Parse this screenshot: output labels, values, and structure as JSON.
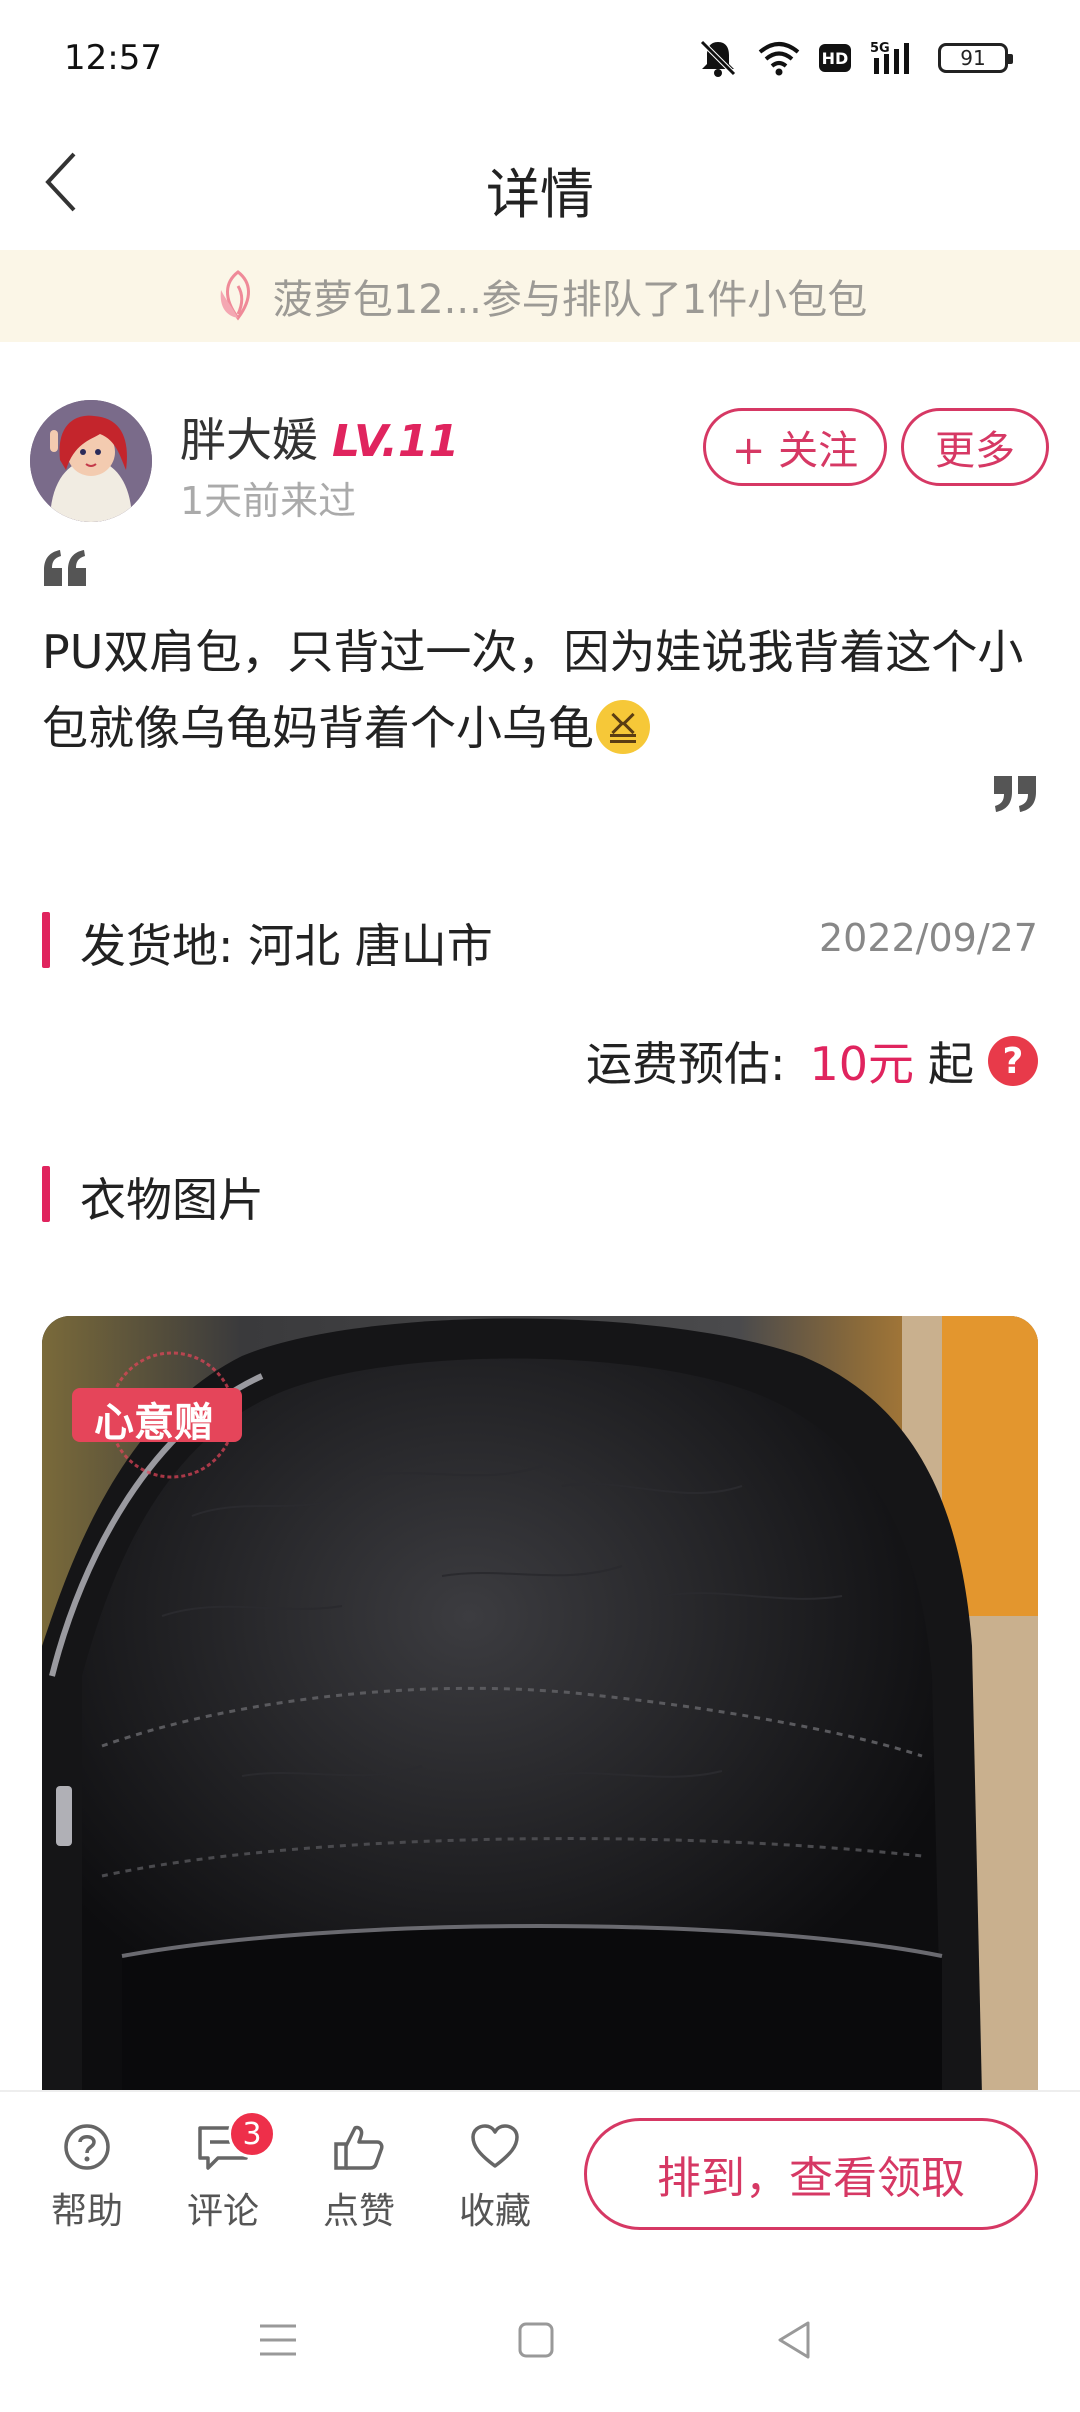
{
  "status_bar": {
    "time": "12:57",
    "battery": "91",
    "network": "5G",
    "hd": "HD"
  },
  "header": {
    "title": "详情"
  },
  "notice": {
    "text": "菠萝包12...参与排队了1件小包包"
  },
  "user": {
    "name": "胖大媛",
    "level": "LV.11",
    "last_seen": "1天前来过",
    "follow_label": "+ 关注",
    "more_label": "更多"
  },
  "post": {
    "description": "PU双肩包，只背过一次，因为娃说我背着这个小包就像乌龟妈背着个小乌龟"
  },
  "location": {
    "label": "发货地: 河北 唐山市",
    "date": "2022/09/27"
  },
  "shipping": {
    "label": "运费预估:",
    "price": "10元",
    "suffix": "起",
    "help_symbol": "?"
  },
  "photos": {
    "section_title": "衣物图片",
    "stamp_text": "心意赠"
  },
  "bottom_bar": {
    "help_label": "帮助",
    "comment_label": "评论",
    "comment_count": "3",
    "like_label": "点赞",
    "favorite_label": "收藏",
    "claim_label": "排到，查看领取"
  },
  "colors": {
    "accent": "#e0245e",
    "banner_bg": "#fbf6e7"
  },
  "icons": [
    "back-icon",
    "flower-icon",
    "quote-open-icon",
    "quote-close-icon",
    "help-icon",
    "comment-icon",
    "like-icon",
    "favorite-icon",
    "menu-icon",
    "home-icon",
    "back-nav-icon"
  ]
}
